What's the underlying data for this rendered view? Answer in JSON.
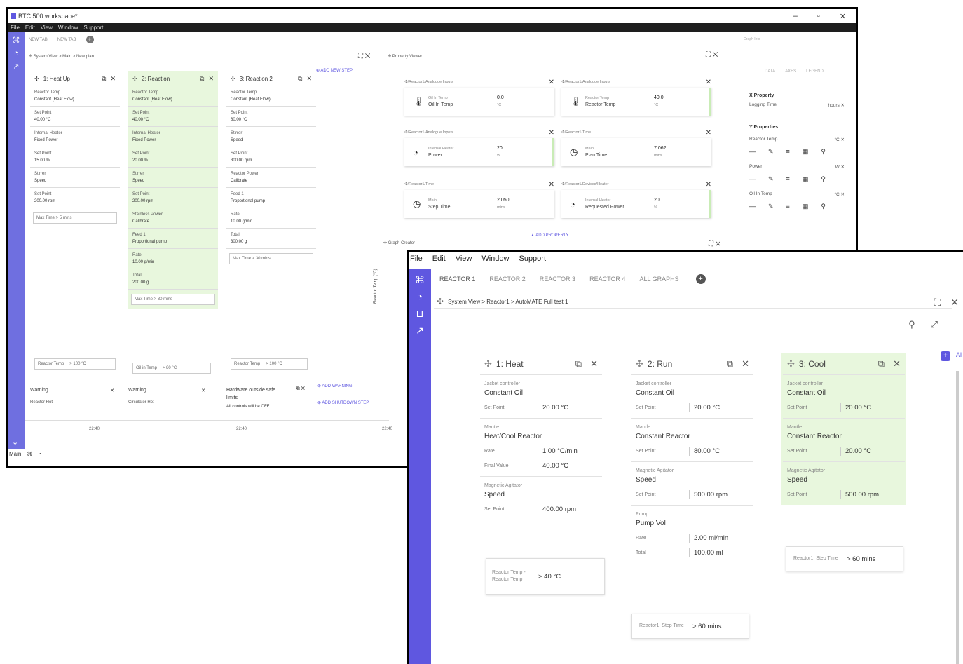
{
  "back": {
    "title": "BTC 500 workspace*",
    "menu": [
      "File",
      "Edit",
      "View",
      "Window",
      "Support"
    ],
    "tabs": [
      "NEW TAB",
      "NEW TAB"
    ],
    "breadcrumb": "System View > Main > New plan",
    "steps": [
      {
        "title": "1: Heat Up",
        "rows": [
          [
            "Reactor Temp",
            "Constant (Heat Flow)"
          ],
          [
            "Set Point",
            "40.00 °C"
          ],
          [
            "Internal Heater",
            "Fixed Power"
          ],
          [
            "Set Point",
            "15.00 %"
          ],
          [
            "Stirrer",
            "Speed"
          ],
          [
            "Set Point",
            "200.00 rpm"
          ]
        ],
        "cond": "Max Time  > 5 mins"
      },
      {
        "title": "2: Reaction",
        "rows": [
          [
            "Reactor Temp",
            "Constant (Heat Flow)"
          ],
          [
            "Set Point",
            "40.00 °C"
          ],
          [
            "Internal Heater",
            "Fixed Power"
          ],
          [
            "Set Point",
            "20.00 %"
          ],
          [
            "Stirrer",
            "Speed"
          ],
          [
            "Set Point",
            "200.00 rpm"
          ],
          [
            "Stainless Power",
            "Calibrate"
          ],
          [
            "Feed 1",
            "Proportional pump"
          ],
          [
            "Rate",
            "10.00 g/min"
          ],
          [
            "Total",
            "200.00 g"
          ]
        ],
        "cond": "Max Time  > 30 mins"
      },
      {
        "title": "3: Reaction 2",
        "rows": [
          [
            "Reactor Temp",
            "Constant (Heat Flow)"
          ],
          [
            "Set Point",
            "80.00 °C"
          ],
          [
            "Stirrer",
            "Speed"
          ],
          [
            "Set Point",
            "300.00 rpm"
          ],
          [
            "Reactor Power",
            "Calibrate"
          ],
          [
            "Feed 1",
            "Proportional pump"
          ],
          [
            "Rate",
            "10.00 g/min"
          ],
          [
            "Total",
            "300.00 g"
          ]
        ],
        "cond": "Max Time  > 30 mins"
      }
    ],
    "add_new_step": "ADD NEW STEP",
    "warnings": [
      {
        "title": "Warning",
        "text": "Reactor Hot"
      },
      {
        "title": "Warning",
        "text": "Circulator Hot"
      },
      {
        "title": "Hardware outside safe limits",
        "text": "All controls will be OFF"
      }
    ],
    "warn_conds": [
      "> 100 °C",
      "> 80 °C",
      "> 100 °C"
    ],
    "add_warning": "ADD WARNING",
    "add_shutdown": "ADD SHUTDOWN STEP",
    "times": [
      "22:40",
      "22:40",
      "22:40"
    ],
    "status": "Main",
    "property_viewer": {
      "title": "Property Viewer",
      "tiles": [
        {
          "hdr": "/Reactor1/Analogue Inputs",
          "icon": "thermometer-icon",
          "label1": "Oil In Temp",
          "label2": "Oil In Temp",
          "value": "0.0",
          "unit": "°C",
          "green": false
        },
        {
          "hdr": "/Reactor1/Analogue Inputs",
          "icon": "thermometer-icon",
          "label1": "Reactor Temp",
          "label2": "Reactor Temp",
          "value": "40.0",
          "unit": "°C",
          "green": true
        },
        {
          "hdr": "/Reactor1/Analogue Inputs",
          "icon": "gauge-icon",
          "label1": "Internal Heater",
          "label2": "Power",
          "value": "20",
          "unit": "W",
          "green": true
        },
        {
          "hdr": "/Reactor1/Time",
          "icon": "clock-icon",
          "label1": "Main",
          "label2": "Plan Time",
          "value": "7.062",
          "unit": "mins",
          "green": false
        },
        {
          "hdr": "/Reactor1/Time",
          "icon": "clock-icon",
          "label1": "Main",
          "label2": "Step Time",
          "value": "2.050",
          "unit": "mins",
          "green": false
        },
        {
          "hdr": "/Reactor1/Devices/Heater",
          "icon": "gauge-icon",
          "label1": "Internal Heater",
          "label2": "Requested Power",
          "value": "20",
          "unit": "%",
          "green": true
        }
      ],
      "add_property": "ADD PROPERTY"
    },
    "graph_creator": "Graph Creator",
    "axis_label": "Reactor Temp (°C)",
    "right_panel": {
      "graph_info": "Graph Info",
      "tabs": [
        "DATA",
        "AXES",
        "LEGEND"
      ],
      "x_property": "X Property",
      "x_value": "Logging Time",
      "x_unit": "hours",
      "y_properties": "Y Properties",
      "y_items": [
        {
          "name": "Reactor Temp",
          "unit": "°C"
        },
        {
          "name": "Power",
          "unit": "W"
        },
        {
          "name": "Oil In Temp",
          "unit": "°C"
        }
      ]
    }
  },
  "front": {
    "menu": [
      "File",
      "Edit",
      "View",
      "Window",
      "Support"
    ],
    "tabs": [
      "REACTOR 1",
      "REACTOR 2",
      "REACTOR 3",
      "REACTOR 4",
      "ALL GRAPHS"
    ],
    "breadcrumb": "System View > Reactor1 > AutoMATE Full test 1",
    "cards": [
      {
        "title": "1: Heat",
        "green": false,
        "segs": [
          {
            "lbl": "Jacket controller",
            "main": "Constant Oil",
            "kv": [
              [
                "Set Point",
                "20.00 °C"
              ]
            ]
          },
          {
            "lbl": "Mantle",
            "main": "Heat/Cool Reactor",
            "kv": [
              [
                "Rate",
                "1.00 °C/min"
              ],
              [
                "Final Value",
                "40.00 °C"
              ]
            ]
          },
          {
            "lbl": "Magnetic Agitator",
            "main": "Speed",
            "kv": [
              [
                "Set Point",
                "400.00 rpm"
              ]
            ]
          }
        ]
      },
      {
        "title": "2: Run",
        "green": false,
        "segs": [
          {
            "lbl": "Jacket controller",
            "main": "Constant Oil",
            "kv": [
              [
                "Set Point",
                "20.00 °C"
              ]
            ]
          },
          {
            "lbl": "Mantle",
            "main": "Constant Reactor",
            "kv": [
              [
                "Set Point",
                "80.00 °C"
              ]
            ]
          },
          {
            "lbl": "Magnetic Agitator",
            "main": "Speed",
            "kv": [
              [
                "Set Point",
                "500.00 rpm"
              ]
            ]
          },
          {
            "lbl": "Pump",
            "main": "Pump Vol",
            "kv": [
              [
                "Rate",
                "2.00 ml/min"
              ],
              [
                "Total",
                "100.00 ml"
              ]
            ]
          }
        ]
      },
      {
        "title": "3: Cool",
        "green": true,
        "segs": [
          {
            "lbl": "Jacket controller",
            "main": "Constant Oil",
            "kv": [
              [
                "Set Point",
                "20.00 °C"
              ]
            ]
          },
          {
            "lbl": "Mantle",
            "main": "Constant Reactor",
            "kv": [
              [
                "Set Point",
                "20.00 °C"
              ]
            ]
          },
          {
            "lbl": "Magnetic Agitator",
            "main": "Speed",
            "kv": [
              [
                "Set Point",
                "500.00 rpm"
              ]
            ]
          }
        ]
      }
    ],
    "conditions": [
      {
        "label": "Reactor Temp - Reactor Temp",
        "value": "> 40 °C"
      },
      {
        "label": "Reactor1: Step Time",
        "value": "> 60 mins"
      },
      {
        "label": "Reactor1: Step Time",
        "value": "> 60 mins"
      }
    ],
    "add_label": "Al"
  }
}
